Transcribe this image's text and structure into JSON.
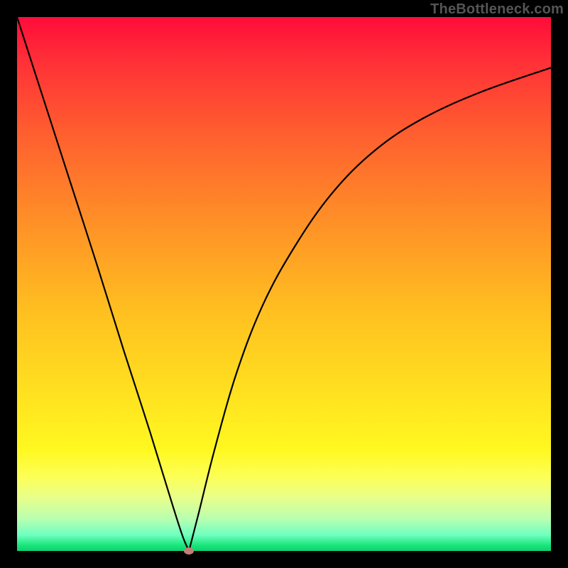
{
  "watermark": "TheBottleneck.com",
  "colors": {
    "frame": "#000000",
    "curve": "#000000",
    "marker": "#c47d75"
  },
  "chart_data": {
    "type": "line",
    "title": "",
    "xlabel": "",
    "ylabel": "",
    "xlim": [
      0,
      1
    ],
    "ylim": [
      0,
      1
    ],
    "grid": false,
    "note": "No numeric axis ticks or labels are visible in the image; values are normalized 0–1 estimates from pixel positions.",
    "series": [
      {
        "name": "left-branch",
        "x": [
          0.0,
          0.05,
          0.1,
          0.15,
          0.2,
          0.25,
          0.29,
          0.31,
          0.322
        ],
        "y": [
          1.0,
          0.845,
          0.69,
          0.535,
          0.375,
          0.22,
          0.09,
          0.028,
          0.0
        ]
      },
      {
        "name": "right-branch",
        "x": [
          0.322,
          0.34,
          0.37,
          0.41,
          0.46,
          0.52,
          0.59,
          0.67,
          0.76,
          0.87,
          1.0
        ],
        "y": [
          0.0,
          0.07,
          0.19,
          0.33,
          0.46,
          0.57,
          0.67,
          0.75,
          0.81,
          0.86,
          0.905
        ]
      }
    ],
    "marker": {
      "x": 0.322,
      "y": 0.0
    }
  }
}
